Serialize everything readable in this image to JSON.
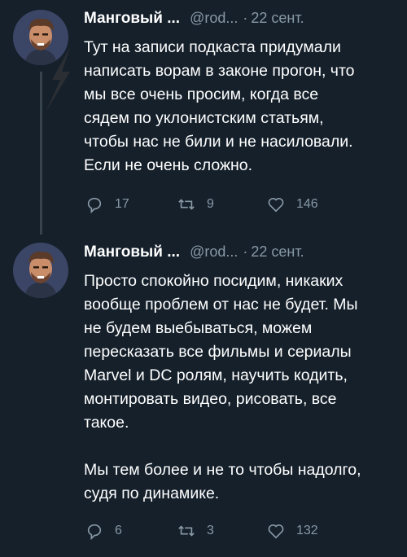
{
  "tweets": [
    {
      "name": "Манговый ...",
      "handle": "@rod...",
      "dot": "·",
      "date": "22 сент.",
      "text": "Тут на записи подкаста придумали\nнаписать ворам в законе прогон, что\nмы все очень просим, когда все\nсядем по уклонистским статьям,\nчтобы нас не били и не насиловали.\nЕсли не очень сложно.",
      "replies": "17",
      "retweets": "9",
      "likes": "146"
    },
    {
      "name": "Манговый ...",
      "handle": "@rod...",
      "dot": "·",
      "date": "22 сент.",
      "text": "Просто спокойно посидим, никаких\nвообще проблем от нас не будет. Мы\nне будем выебываться, можем\nпересказать все фильмы и сериалы\nMarvel и DC ролям, научить кодить,\nмонтировать видео, рисовать, все\nтакое.\n\nМы тем более и не то чтобы надолго,\nсудя по динамике.",
      "replies": "6",
      "retweets": "3",
      "likes": "132"
    }
  ],
  "icons": [
    "avatar",
    "reply-icon",
    "retweet-icon",
    "like-icon"
  ],
  "colors": {
    "background": "#15202b",
    "secondary_text": "#8899a6",
    "thread_line": "#38444d"
  }
}
